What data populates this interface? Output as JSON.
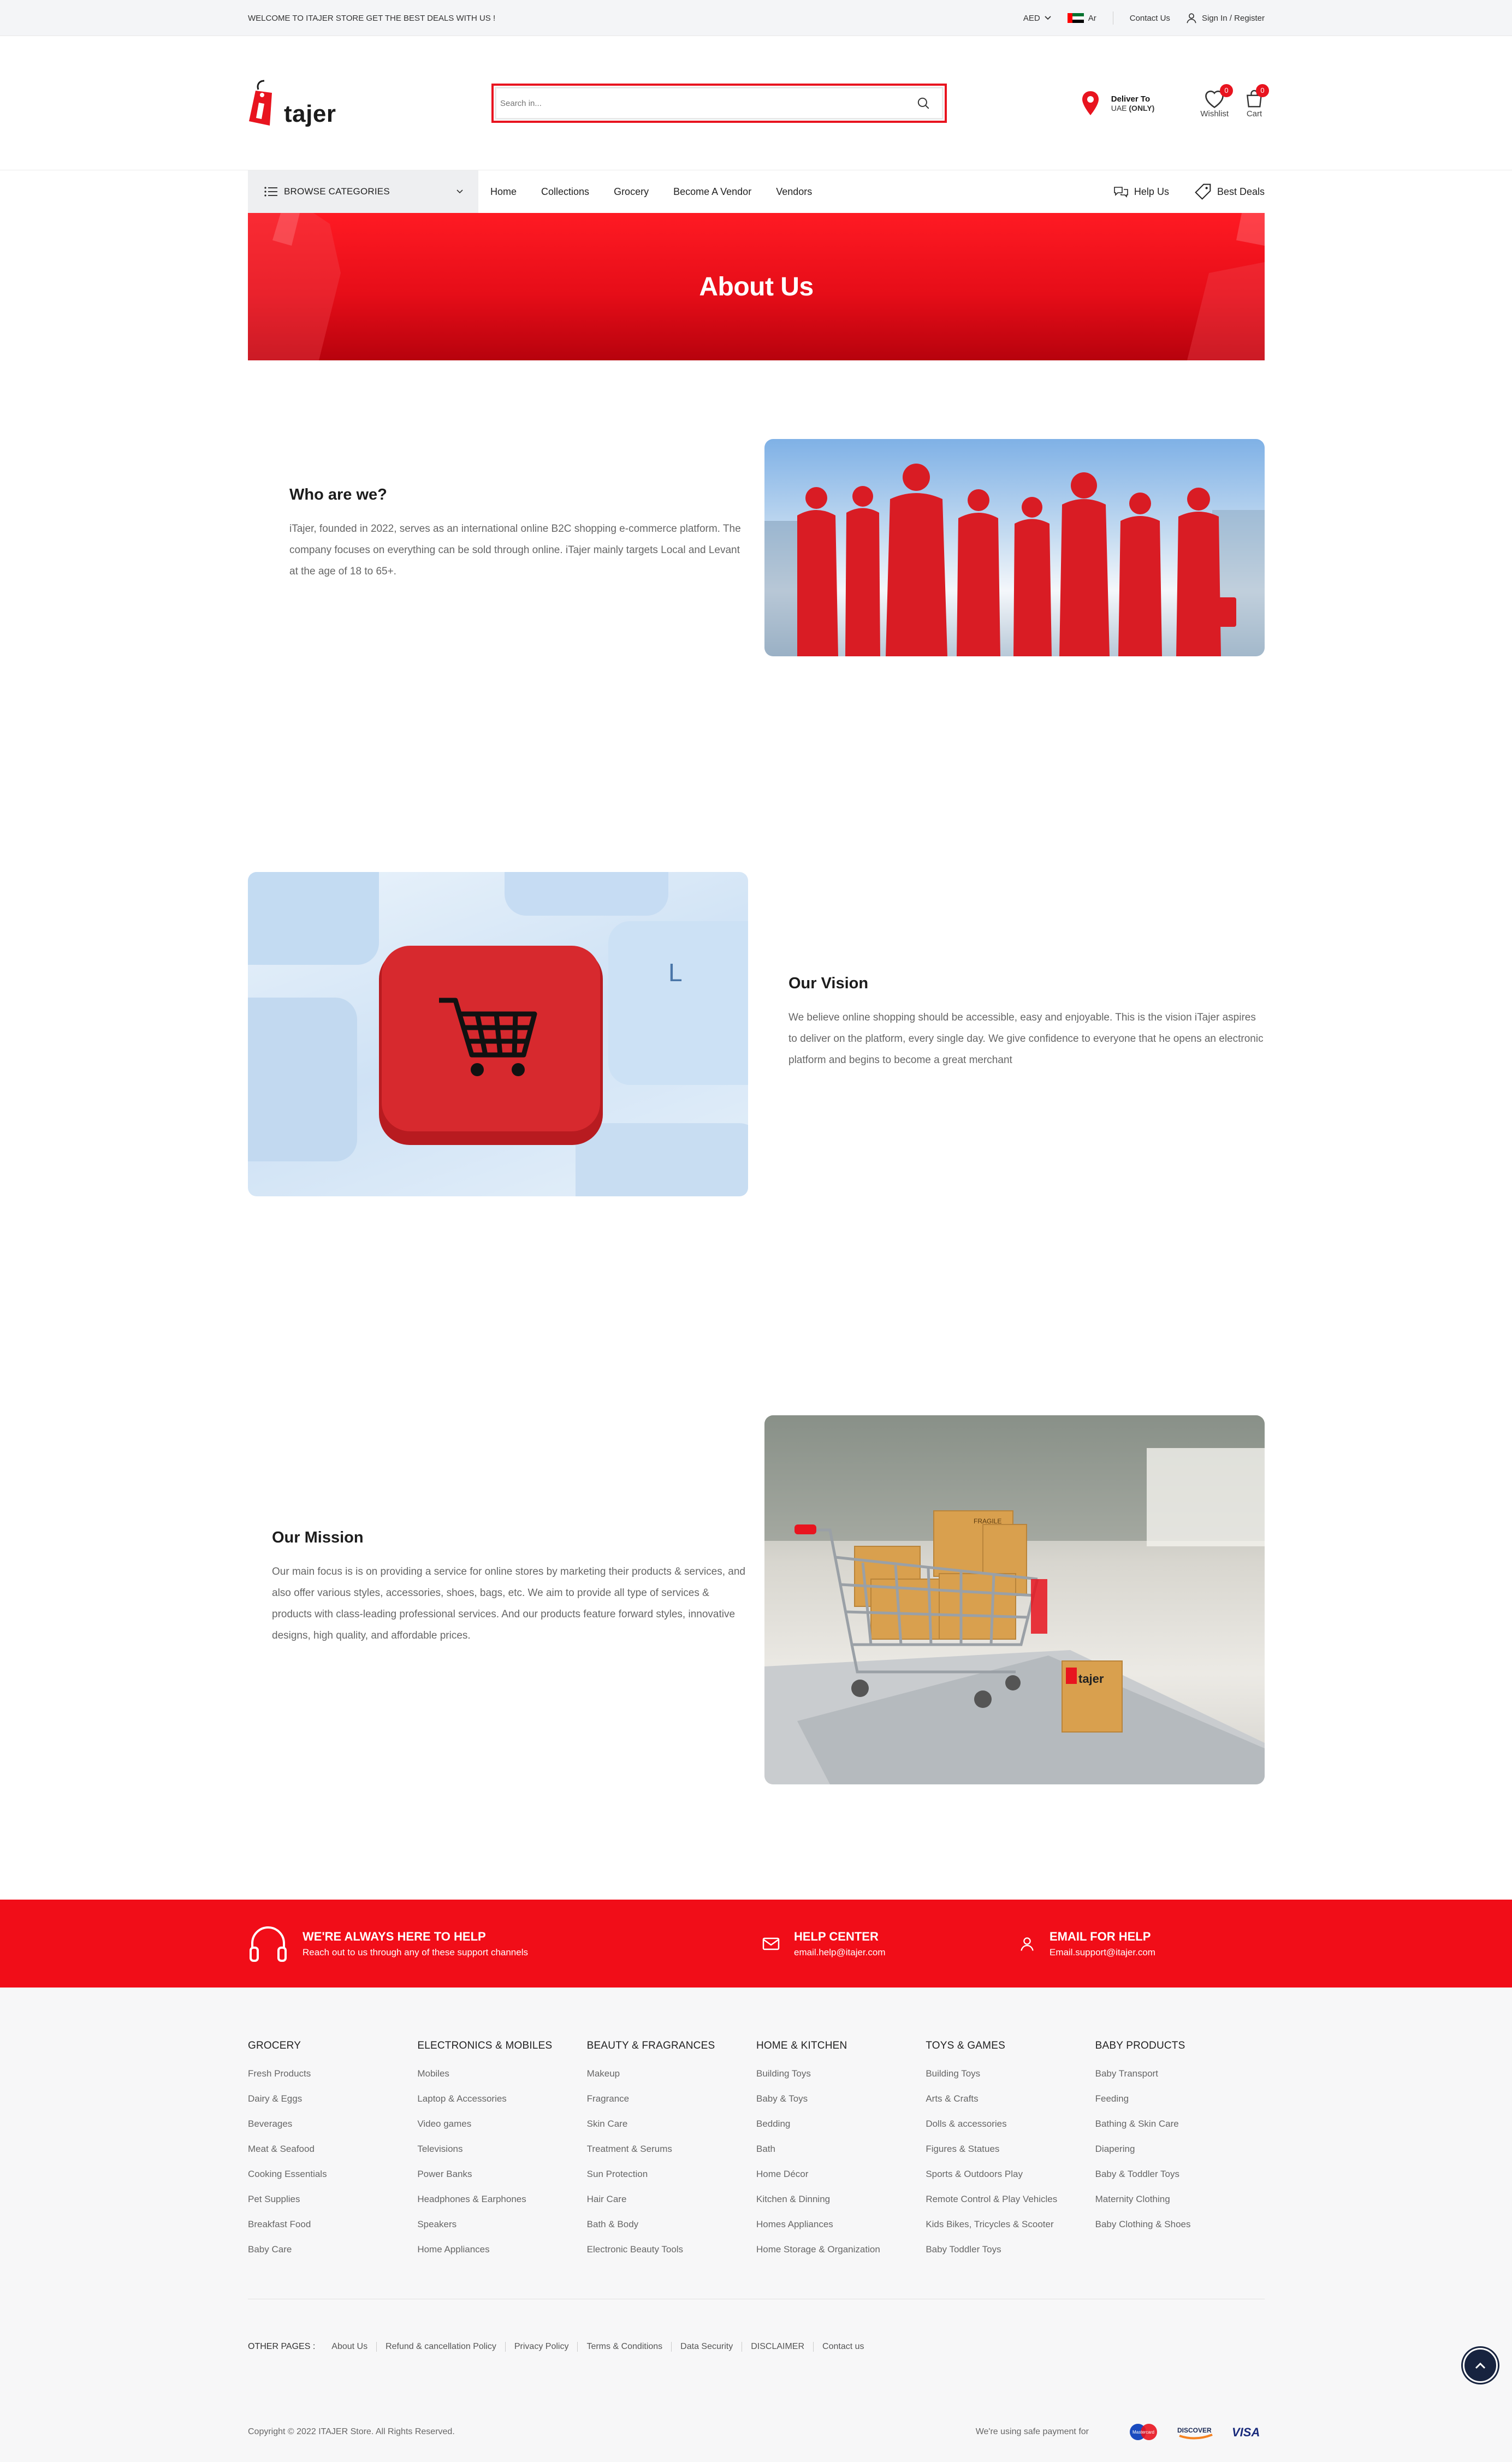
{
  "topbar": {
    "welcome": "WELCOME TO ITAJER STORE GET THE BEST DEALS WITH US !",
    "currency": "AED",
    "language": "Ar",
    "contact": "Contact Us",
    "signin": "Sign In / Register"
  },
  "header": {
    "logo_text": "tajer",
    "search_placeholder": "Search in...",
    "deliver_label": "Deliver To",
    "deliver_region": "UAE",
    "deliver_note": "(ONLY)",
    "wishlist_label": "Wishlist",
    "wishlist_count": "0",
    "cart_label": "Cart",
    "cart_count": "0"
  },
  "nav": {
    "browse": "BROWSE CATEGORIES",
    "items": [
      "Home",
      "Collections",
      "Grocery",
      "Become A Vendor",
      "Vendors"
    ],
    "help": "Help Us",
    "deals": "Best Deals"
  },
  "banner": {
    "title": "About Us"
  },
  "about": {
    "who_title": "Who are we?",
    "who_text": "iTajer, founded in 2022, serves as an international online B2C shopping e-commerce platform. The company focuses on everything can be sold through online. iTajer mainly targets Local and Levant at the age of 18 to 65+.",
    "vision_title": "Our Vision",
    "vision_text": "We believe online shopping should be accessible, easy and enjoyable. This is the vision iTajer aspires to deliver on the platform, every single day. We give confidence to everyone that he opens an electronic platform and begins to become a great merchant",
    "mission_title": "Our Mission",
    "mission_text": "Our main focus is is on providing a service for online stores by marketing their products & services, and also offer various styles, accessories, shoes, bags, etc. We aim to provide all type of services & products with class-leading professional services. And our products feature forward styles, innovative designs, high quality, and affordable prices.",
    "box_brand": "tajer",
    "box_fragile": "FRAGILE"
  },
  "helpbar": {
    "h1": "WE'RE ALWAYS HERE TO HELP",
    "s1": "Reach out to us through any of these support channels",
    "h2": "HELP CENTER",
    "s2": "email.help@itajer.com",
    "h3": "EMAIL FOR HELP",
    "s3": "Email.support@itajer.com"
  },
  "footer": {
    "columns": [
      {
        "title": "GROCERY",
        "items": [
          "Fresh Products",
          "Dairy & Eggs",
          "Beverages",
          "Meat & Seafood",
          "Cooking Essentials",
          "Pet Supplies",
          "Breakfast Food",
          "Baby Care"
        ]
      },
      {
        "title": "ELECTRONICS & MOBILES",
        "items": [
          "Mobiles",
          "Laptop & Accessories",
          "Video games",
          "Televisions",
          "Power Banks",
          "Headphones & Earphones",
          "Speakers",
          "Home Appliances"
        ]
      },
      {
        "title": "BEAUTY & FRAGRANCES",
        "items": [
          "Makeup",
          "Fragrance",
          "Skin Care",
          "Treatment & Serums",
          "Sun Protection",
          "Hair Care",
          "Bath & Body",
          "Electronic Beauty Tools"
        ]
      },
      {
        "title": "HOME & KITCHEN",
        "items": [
          "Building Toys",
          "Baby & Toys",
          "Bedding",
          "Bath",
          "Home Décor",
          "Kitchen & Dinning",
          "Homes Appliances",
          "Home Storage & Organization"
        ]
      },
      {
        "title": "TOYS & GAMES",
        "items": [
          "Building Toys",
          "Arts & Crafts",
          "Dolls & accessories",
          "Figures & Statues",
          "Sports & Outdoors Play",
          "Remote Control & Play Vehicles",
          "Kids Bikes, Tricycles & Scooter",
          "Baby Toddler Toys"
        ]
      },
      {
        "title": "BABY PRODUCTS",
        "items": [
          "Baby Transport",
          "Feeding",
          "Bathing & Skin Care",
          "Diapering",
          "Baby & Toddler Toys",
          "Maternity Clothing",
          "Baby Clothing & Shoes"
        ]
      }
    ],
    "other_label": "OTHER PAGES :",
    "other_links": [
      "About Us",
      "Refund & cancellation Policy",
      "Privacy Policy",
      "Terms & Conditions",
      "Data Security",
      "DISCLAIMER",
      "Contact us"
    ],
    "copyright": "Copyright © 2022 ITAJER Store. All Rights Reserved.",
    "payment_note": "We're using safe payment for",
    "pay_mastercard": "Mastercard",
    "pay_discover": "DISCOVER",
    "pay_visa": "VISA"
  }
}
